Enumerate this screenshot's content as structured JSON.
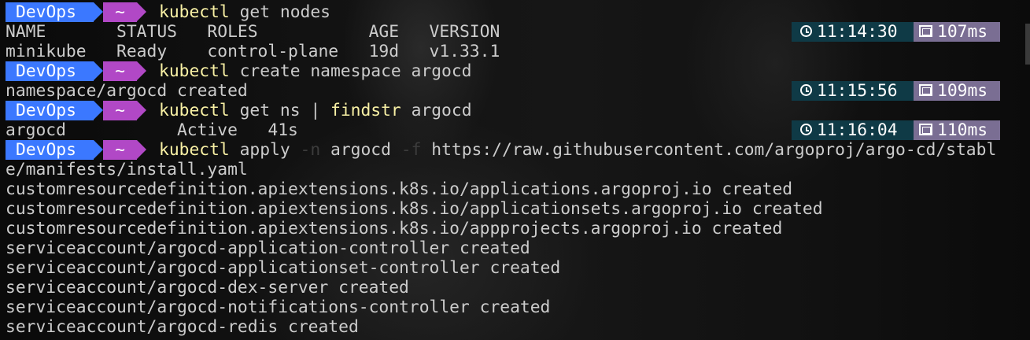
{
  "prompt": {
    "segment1": "DevOps",
    "segment2": "~"
  },
  "blocks": [
    {
      "command": {
        "parts": [
          "kubectl",
          " get nodes"
        ]
      },
      "status": {
        "time": "11:14:30",
        "duration": "107ms"
      },
      "output": [
        "NAME       STATUS   ROLES           AGE   VERSION",
        "minikube   Ready    control-plane   19d   v1.33.1"
      ]
    },
    {
      "command": {
        "parts": [
          "kubectl",
          " create namespace argocd"
        ]
      },
      "status": {
        "time": "11:15:56",
        "duration": "109ms"
      },
      "output": [
        "namespace/argocd created"
      ]
    },
    {
      "command": {
        "parts": [
          "kubectl",
          " get ns ",
          "|",
          " ",
          "findstr",
          " argocd"
        ]
      },
      "status": {
        "time": "11:16:04",
        "duration": "110ms"
      },
      "output": [
        "argocd           Active   41s"
      ]
    },
    {
      "command": {
        "parts": [
          "kubectl",
          " apply ",
          "-n",
          " argocd ",
          "-f",
          " https://raw.githubusercontent.com/argoproj/argo-cd/stabl"
        ],
        "wrap": "e/manifests/install.yaml"
      },
      "output": [
        "customresourcedefinition.apiextensions.k8s.io/applications.argoproj.io created",
        "customresourcedefinition.apiextensions.k8s.io/applicationsets.argoproj.io created",
        "customresourcedefinition.apiextensions.k8s.io/appprojects.argoproj.io created",
        "serviceaccount/argocd-application-controller created",
        "serviceaccount/argocd-applicationset-controller created",
        "serviceaccount/argocd-dex-server created",
        "serviceaccount/argocd-notifications-controller created",
        "serviceaccount/argocd-redis created"
      ]
    }
  ]
}
